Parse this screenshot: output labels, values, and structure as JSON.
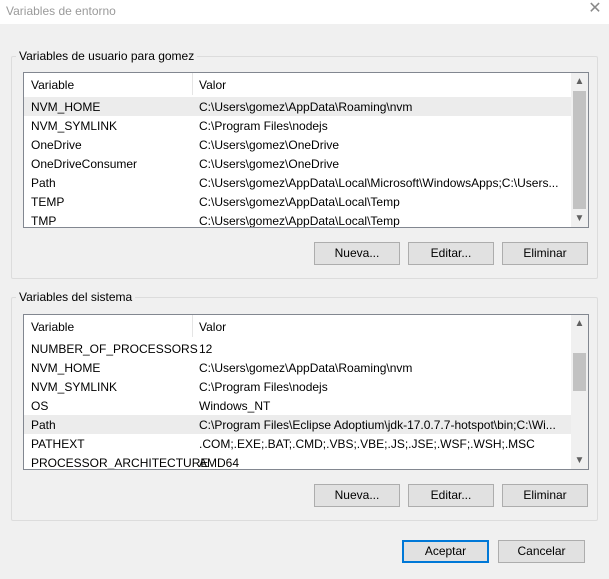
{
  "window": {
    "title": "Variables de entorno"
  },
  "user_vars": {
    "legend": "Variables de usuario para gomez",
    "columns": [
      "Variable",
      "Valor"
    ],
    "rows": [
      {
        "name": "NVM_HOME",
        "value": "C:\\Users\\gomez\\AppData\\Roaming\\nvm",
        "selected": true
      },
      {
        "name": "NVM_SYMLINK",
        "value": "C:\\Program Files\\nodejs"
      },
      {
        "name": "OneDrive",
        "value": "C:\\Users\\gomez\\OneDrive"
      },
      {
        "name": "OneDriveConsumer",
        "value": "C:\\Users\\gomez\\OneDrive"
      },
      {
        "name": "Path",
        "value": "C:\\Users\\gomez\\AppData\\Local\\Microsoft\\WindowsApps;C:\\Users..."
      },
      {
        "name": "TEMP",
        "value": "C:\\Users\\gomez\\AppData\\Local\\Temp"
      },
      {
        "name": "TMP",
        "value": "C:\\Users\\gomez\\AppData\\Local\\Temp"
      }
    ],
    "buttons": {
      "new": "Nueva...",
      "edit": "Editar...",
      "delete": "Eliminar"
    }
  },
  "system_vars": {
    "legend": "Variables del sistema",
    "columns": [
      "Variable",
      "Valor"
    ],
    "rows": [
      {
        "name": "NUMBER_OF_PROCESSORS",
        "value": "12"
      },
      {
        "name": "NVM_HOME",
        "value": "C:\\Users\\gomez\\AppData\\Roaming\\nvm"
      },
      {
        "name": "NVM_SYMLINK",
        "value": "C:\\Program Files\\nodejs"
      },
      {
        "name": "OS",
        "value": "Windows_NT"
      },
      {
        "name": "Path",
        "value": "C:\\Program Files\\Eclipse Adoptium\\jdk-17.0.7.7-hotspot\\bin;C:\\Wi...",
        "selected": true
      },
      {
        "name": "PATHEXT",
        "value": ".COM;.EXE;.BAT;.CMD;.VBS;.VBE;.JS;.JSE;.WSF;.WSH;.MSC"
      },
      {
        "name": "PROCESSOR_ARCHITECTURE",
        "value": "AMD64"
      }
    ],
    "buttons": {
      "new": "Nueva...",
      "edit": "Editar...",
      "delete": "Eliminar"
    }
  },
  "dialog_buttons": {
    "accept": "Aceptar",
    "cancel": "Cancelar"
  },
  "icons": {
    "close": "close-icon",
    "up": "chevron-up-icon",
    "down": "chevron-down-icon"
  }
}
